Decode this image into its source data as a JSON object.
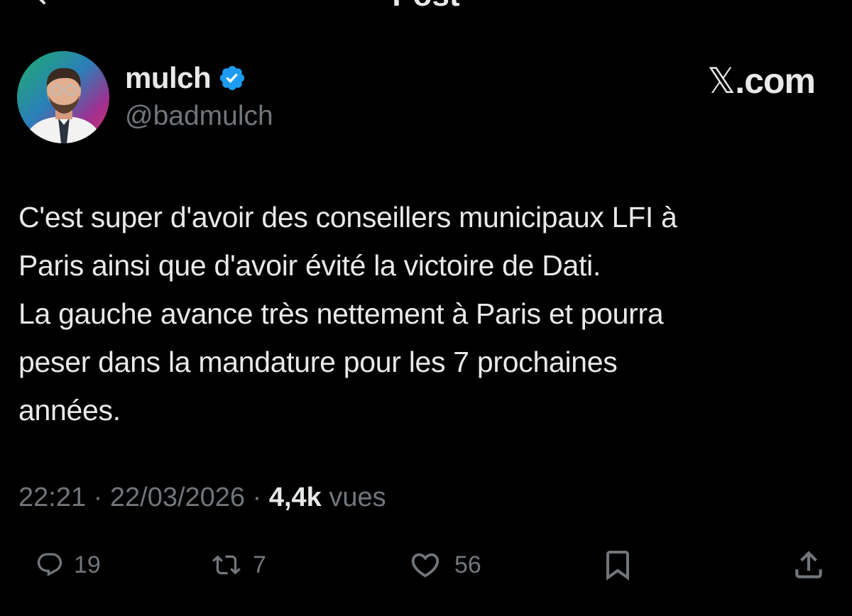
{
  "header": {
    "title": "Post"
  },
  "author": {
    "display_name": "mulch",
    "handle": "@badmulch",
    "verified": true
  },
  "watermark": {
    "mark": "𝕏",
    "label": ".com"
  },
  "tweet": {
    "lines": [
      "C'est super d'avoir des conseillers municipaux LFI à",
      "Paris ainsi que d'avoir évité la victoire de Dati.",
      "La gauche avance très nettement à Paris et pourra",
      "peser dans la mandature pour les 7 prochaines",
      "années."
    ]
  },
  "meta": {
    "time": "22:21",
    "separator": " · ",
    "date": "22/03/2026",
    "views_count": "4,4k",
    "views_label": " vues"
  },
  "actions": {
    "reply_count": "19",
    "retweet_count": "7",
    "like_count": "56"
  },
  "colors": {
    "background": "#000000",
    "text": "#e7e9ea",
    "secondary": "#71767b",
    "verified_blue": "#1d9bf0"
  },
  "icons": [
    "back-arrow-icon",
    "verified-badge-icon",
    "reply-icon",
    "retweet-icon",
    "like-icon",
    "bookmark-icon",
    "share-icon"
  ]
}
